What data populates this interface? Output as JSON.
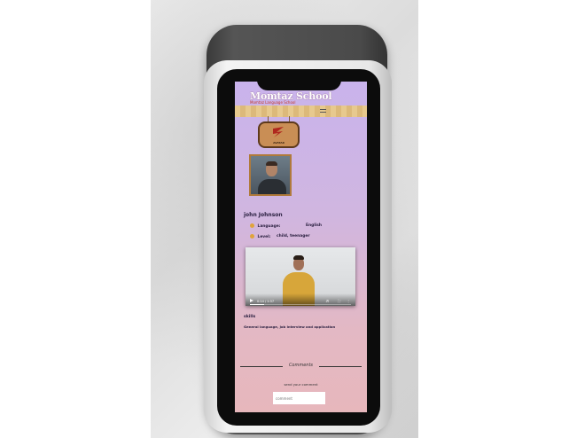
{
  "header": {
    "brand": "Momtaz School",
    "brand_sub": "Momtaz Language School",
    "menu_icon": "hamburger-menu-icon"
  },
  "sign": {
    "text": "AVATAR",
    "icon": "logo-swoosh-icon"
  },
  "profile": {
    "name": "john Johnson",
    "language_label": "Language:",
    "language_value": "English",
    "level_label": "Level:",
    "level_value": "child, teenager"
  },
  "video": {
    "time": "0:14 / 1:37",
    "progress": 0.14
  },
  "skills": {
    "title": "skills",
    "text": "General language, job interview and application"
  },
  "comments": {
    "title": "Comments",
    "send_label": "send your comment",
    "placeholder": "comment"
  },
  "colors": {
    "screen_top": "#c9b3ec",
    "screen_bottom": "#e7b7bc",
    "accent": "#e0a33c"
  }
}
